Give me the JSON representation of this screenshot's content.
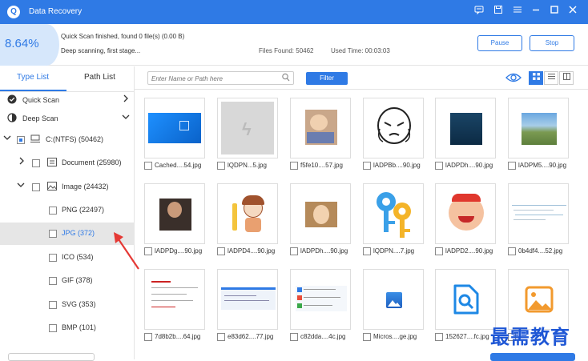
{
  "window": {
    "title": "Data Recovery",
    "logo_glyph": "Q"
  },
  "status": {
    "progress_percent": "8.64%",
    "line1": "Quick Scan finished, found 0 file(s) (0.00  B)",
    "line2": "Deep scanning, first stage...",
    "files_found": "Files Found: 50462",
    "used_time": "Used Time: 00:03:03",
    "pause_label": "Pause",
    "stop_label": "Stop"
  },
  "sidebar": {
    "tabs": [
      {
        "label": "Type List"
      },
      {
        "label": "Path List"
      }
    ],
    "quick_scan": "Quick Scan",
    "deep_scan": "Deep Scan",
    "drive": "C:(NTFS) (50462)",
    "document": "Document (25980)",
    "image": "Image (24432)",
    "types": [
      {
        "label": "PNG (22497)"
      },
      {
        "label": "JPG (372)"
      },
      {
        "label": "ICO (534)"
      },
      {
        "label": "GIF (378)"
      },
      {
        "label": "SVG (353)"
      },
      {
        "label": "BMP (101)"
      }
    ]
  },
  "toolbar": {
    "search_placeholder": "Enter Name or Path here",
    "filter_label": "Filter"
  },
  "files": [
    {
      "name": "Cached....54.jpg"
    },
    {
      "name": "lQDPN...5.jpg"
    },
    {
      "name": "f5fe10....57.jpg"
    },
    {
      "name": "lADPBb....90.jpg"
    },
    {
      "name": "lADPDh....90.jpg"
    },
    {
      "name": "lADPM5....90.jpg"
    },
    {
      "name": "lADPDg....90.jpg"
    },
    {
      "name": "lADPD4....90.jpg"
    },
    {
      "name": "lADPDh....90.jpg"
    },
    {
      "name": "lQDPN....7.jpg"
    },
    {
      "name": "lADPD2....90.jpg"
    },
    {
      "name": "0b4df4....52.jpg"
    },
    {
      "name": "7d8b2b....64.jpg"
    },
    {
      "name": "e83d62....77.jpg"
    },
    {
      "name": "c82dda....4c.jpg"
    },
    {
      "name": "Micros....ge.jpg"
    },
    {
      "name": "152627....fc.jpg"
    },
    {
      "name": ""
    }
  ],
  "watermark": "最需教育",
  "colors": {
    "accent": "#2f7ae5",
    "selected_row": "#e6e6e6",
    "annotation_arrow": "#e53935"
  }
}
